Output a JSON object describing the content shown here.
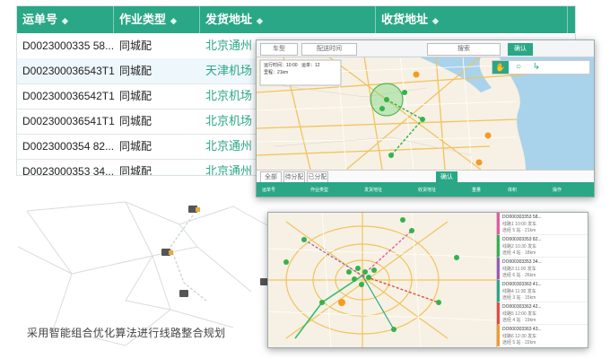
{
  "table": {
    "columns": [
      "运单号",
      "作业类型",
      "发货地址",
      "收货地址"
    ],
    "rows": [
      {
        "id": "D0023000335 58...",
        "type": "同城配",
        "from": "北京通州"
      },
      {
        "id": "D002300036543T1",
        "type": "同城配",
        "from": "天津机场"
      },
      {
        "id": "D002300036542T1",
        "type": "同城配",
        "from": "北京机场"
      },
      {
        "id": "D002300036541T1",
        "type": "同城配",
        "from": "北京机场"
      },
      {
        "id": "D0023000354 82...",
        "type": "同城配",
        "from": "北京通州"
      },
      {
        "id": "D0023000353 34...",
        "type": "同城配",
        "from": "北京通州"
      }
    ]
  },
  "caption": "采用智能组合优化算法进行线路整合规划",
  "map1": {
    "toolbar_labels": [
      "车型",
      "配送时间",
      "搜索",
      "确认"
    ],
    "info": [
      "运行时间：10:00",
      "里程：21km",
      "运单：12"
    ],
    "bottom_bar": [
      "全部",
      "待分配",
      "已分配",
      "确认"
    ],
    "grid_header": [
      "运单号",
      "作业类型",
      "发货地址",
      "收货地址",
      "重量",
      "体积",
      "操作"
    ]
  },
  "map2": {
    "list": [
      {
        "title": "DO000303353 58...",
        "line1": "线路1 10:00 发车",
        "line2": "途经 5 站 · 21km"
      },
      {
        "title": "DO000303353 82...",
        "line1": "线路2 10:30 发车",
        "line2": "途经 4 站 · 18km"
      },
      {
        "title": "DO000303353 34...",
        "line1": "线路3 11:00 发车",
        "line2": "途经 6 站 · 26km"
      },
      {
        "title": "DO000303363 41...",
        "line1": "线路4 11:30 发车",
        "line2": "途经 3 站 · 15km"
      },
      {
        "title": "DO000303363 42...",
        "line1": "线路5 12:00 发车",
        "line2": "途经 4 站 · 19km"
      },
      {
        "title": "DO000303363 43...",
        "line1": "线路6 12:30 发车",
        "line2": "途经 5 站 · 22km"
      }
    ]
  },
  "colors": {
    "accent": "#2aa786",
    "marker_green": "#33b34a",
    "marker_orange": "#f59a23",
    "water": "#a9d3ea"
  }
}
